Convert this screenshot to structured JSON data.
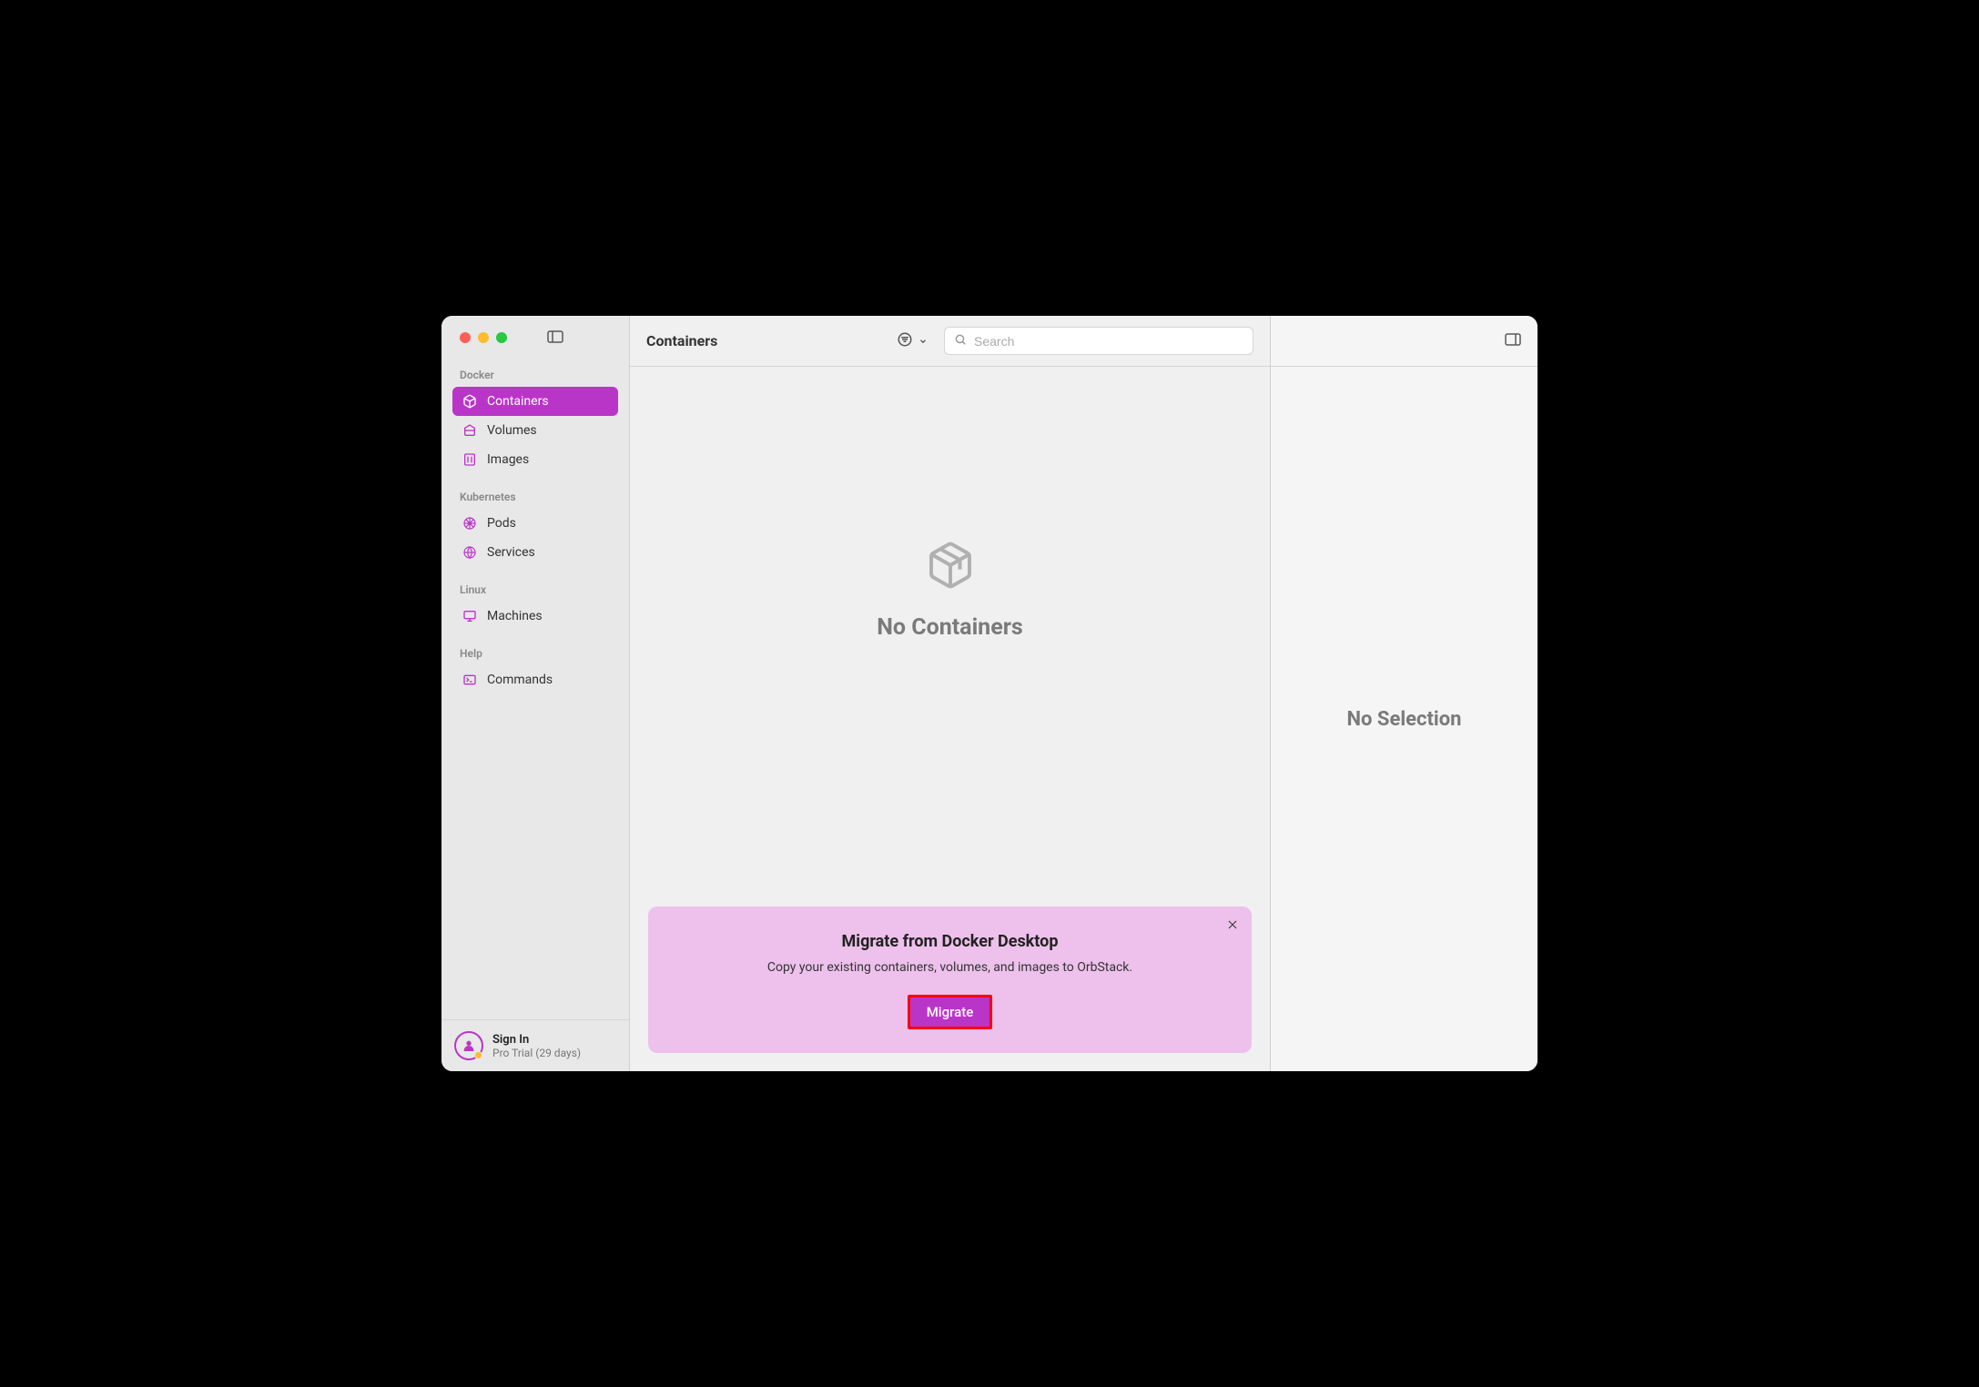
{
  "header": {
    "title": "Containers",
    "search_placeholder": "Search"
  },
  "sidebar": {
    "sections": [
      {
        "header": "Docker",
        "items": [
          {
            "label": "Containers",
            "icon": "box-icon",
            "active": true
          },
          {
            "label": "Volumes",
            "icon": "disk-icon",
            "active": false
          },
          {
            "label": "Images",
            "icon": "image-icon",
            "active": false
          }
        ]
      },
      {
        "header": "Kubernetes",
        "items": [
          {
            "label": "Pods",
            "icon": "helm-icon",
            "active": false
          },
          {
            "label": "Services",
            "icon": "globe-icon",
            "active": false
          }
        ]
      },
      {
        "header": "Linux",
        "items": [
          {
            "label": "Machines",
            "icon": "monitor-icon",
            "active": false
          }
        ]
      },
      {
        "header": "Help",
        "items": [
          {
            "label": "Commands",
            "icon": "terminal-icon",
            "active": false
          }
        ]
      }
    ]
  },
  "footer": {
    "title": "Sign In",
    "subtitle": "Pro Trial (29 days)"
  },
  "empty": {
    "title": "No Containers"
  },
  "banner": {
    "title": "Migrate from Docker Desktop",
    "body": "Copy your existing containers, volumes, and images to OrbStack.",
    "button": "Migrate"
  },
  "detail": {
    "empty": "No Selection"
  },
  "colors": {
    "accent": "#b935c8",
    "banner_bg": "#eec0ec",
    "highlight_border": "#f00"
  }
}
